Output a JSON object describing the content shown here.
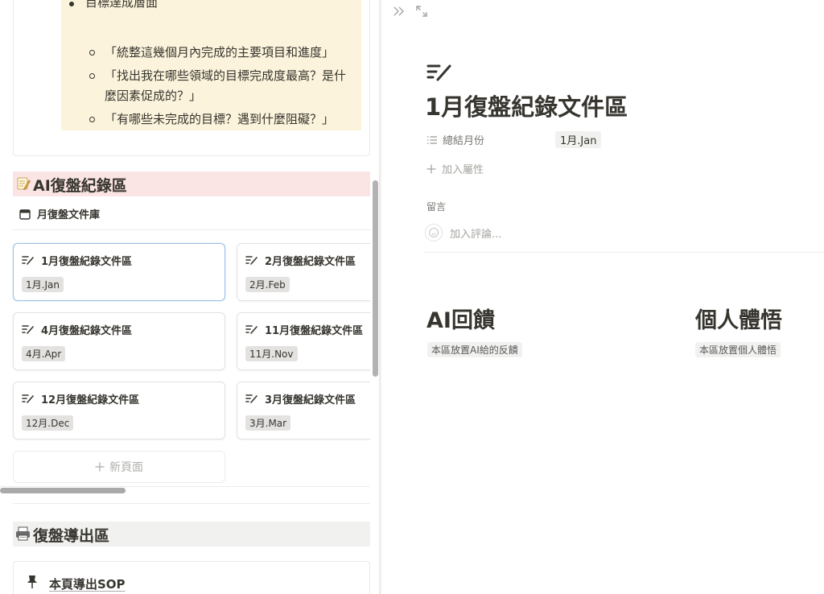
{
  "left": {
    "callout": {
      "cut_bullet": "目標達成層面",
      "questions": [
        "「統整這幾個月內完成的主要項目和進度」",
        "「找出我在哪些領域的目標完成度最高？是什麼因素促成的？」",
        "「有哪些未完成的目標？遇到什麼阻礙？」"
      ]
    },
    "ai_heading": "AI復盤紀錄區",
    "database_title": "月復盤文件庫",
    "cards": [
      {
        "title": "1月復盤紀錄文件區",
        "tag": "1月.Jan"
      },
      {
        "title": "2月復盤紀錄文件區",
        "tag": "2月.Feb"
      },
      {
        "title": "4月復盤紀錄文件區",
        "tag": "4月.Apr"
      },
      {
        "title": "11月復盤紀錄文件區",
        "tag": "11月.Nov"
      },
      {
        "title": "12月復盤紀錄文件區",
        "tag": "12月.Dec"
      },
      {
        "title": "3月復盤紀錄文件區",
        "tag": "3月.Mar"
      }
    ],
    "new_page_label": "新頁面",
    "export_heading": "復盤導出區",
    "sop_link": "本頁導出SOP"
  },
  "right": {
    "page_title": "1月復盤紀錄文件區",
    "property_name": "總結月份",
    "property_value": "1月.Jan",
    "add_property": "加入屬性",
    "comments_heading": "留言",
    "add_comment": "加入評論...",
    "columns": [
      {
        "heading": "AI回饋",
        "tag": "本區放置AI給的反饋"
      },
      {
        "heading": "個人體悟",
        "tag": "本區放置個人體悟"
      }
    ]
  },
  "icons": {
    "page_icon": "edit-list-icon",
    "database_icon": "calendar-icon",
    "ai_emoji": "memo-icon",
    "export_emoji": "printer-icon",
    "sop_icon": "pin-icon",
    "close_peek": "double-chevron-right-icon",
    "expand": "expand-icon"
  },
  "colors": {
    "callout_bg": "#fbf3db",
    "ai_heading_bg": "#fbe4e4",
    "export_heading_bg": "#f1f1ef",
    "selected_card_border": "#9cbfe6"
  }
}
